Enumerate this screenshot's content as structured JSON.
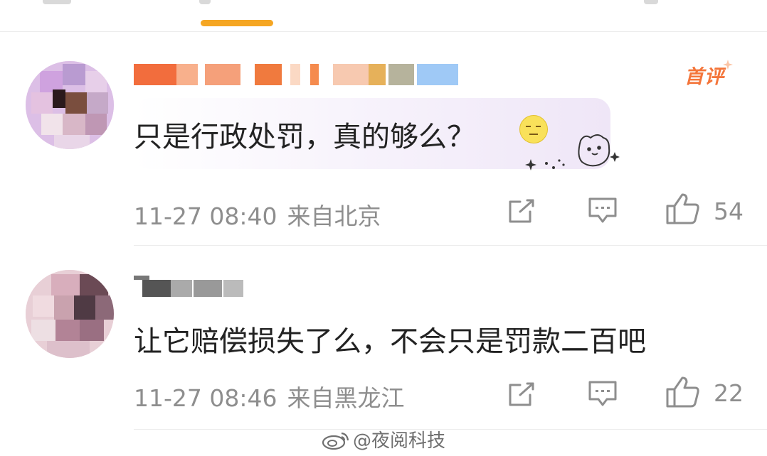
{
  "comments": [
    {
      "badge": "首评",
      "text": "只是行政处罚，真的够么？",
      "time": "11-27 08:40",
      "location": "来自北京",
      "likes": "54"
    },
    {
      "text": "让它赔偿损失了么，不会只是罚款二百吧",
      "time": "11-27 08:46",
      "location": "来自黑龙江",
      "likes": "22"
    }
  ],
  "watermark": "@夜阅科技",
  "colors": {
    "accent": "#f5a623",
    "badge": "#f4753a",
    "meta_text": "#8e8e8e",
    "body_text": "#222222"
  },
  "icons": [
    "share-icon",
    "comment-icon",
    "like-icon",
    "emoji-icon",
    "weibo-logo"
  ]
}
